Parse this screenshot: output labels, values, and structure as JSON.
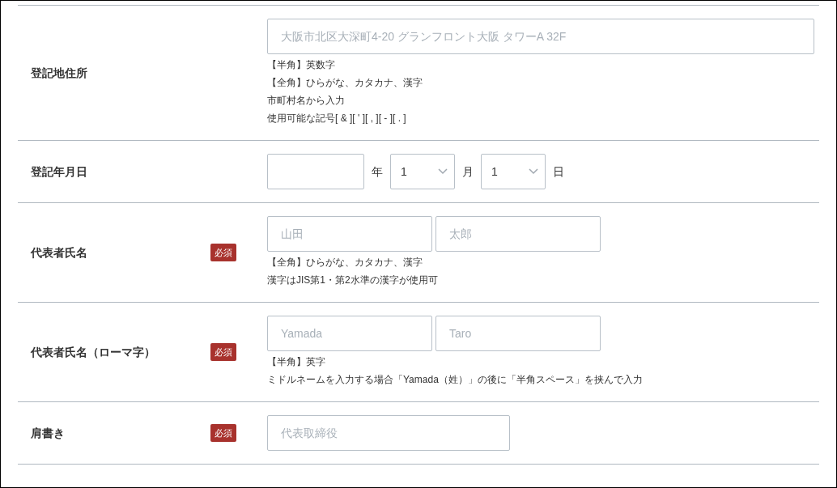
{
  "rows": [
    {
      "kind": "address",
      "label": "登記地住所",
      "required": false,
      "fields": [
        {
          "placeholder": "大阪市北区大深町4-20 グランフロント大阪 タワーA 32F"
        }
      ],
      "hints": [
        "【半角】英数字",
        "【全角】ひらがな、カタカナ、漢字",
        "市町村名から入力",
        "使用可能な記号[ & ][ ' ][ , ][ - ][ . ]"
      ]
    },
    {
      "kind": "date",
      "label": "登記年月日",
      "required": false,
      "year_unit": "年",
      "month": {
        "value": "1",
        "unit": "月"
      },
      "day": {
        "value": "1",
        "unit": "日"
      }
    },
    {
      "kind": "name",
      "label": "代表者氏名",
      "required": true,
      "badge": "必須",
      "fields": [
        {
          "placeholder": "山田"
        },
        {
          "placeholder": "太郎"
        }
      ],
      "hints": [
        "【全角】ひらがな、カタカナ、漢字",
        "漢字はJIS第1・第2水準の漢字が使用可"
      ]
    },
    {
      "kind": "name",
      "label": "代表者氏名（ローマ字）",
      "required": true,
      "badge": "必須",
      "fields": [
        {
          "placeholder": "Yamada"
        },
        {
          "placeholder": "Taro"
        }
      ],
      "hints": [
        "【半角】英字",
        "ミドルネームを入力する場合「Yamada（姓）」の後に「半角スペース」を挟んで入力"
      ]
    },
    {
      "kind": "title",
      "label": "肩書き",
      "required": true,
      "badge": "必須",
      "fields": [
        {
          "placeholder": "代表取締役"
        }
      ]
    }
  ]
}
